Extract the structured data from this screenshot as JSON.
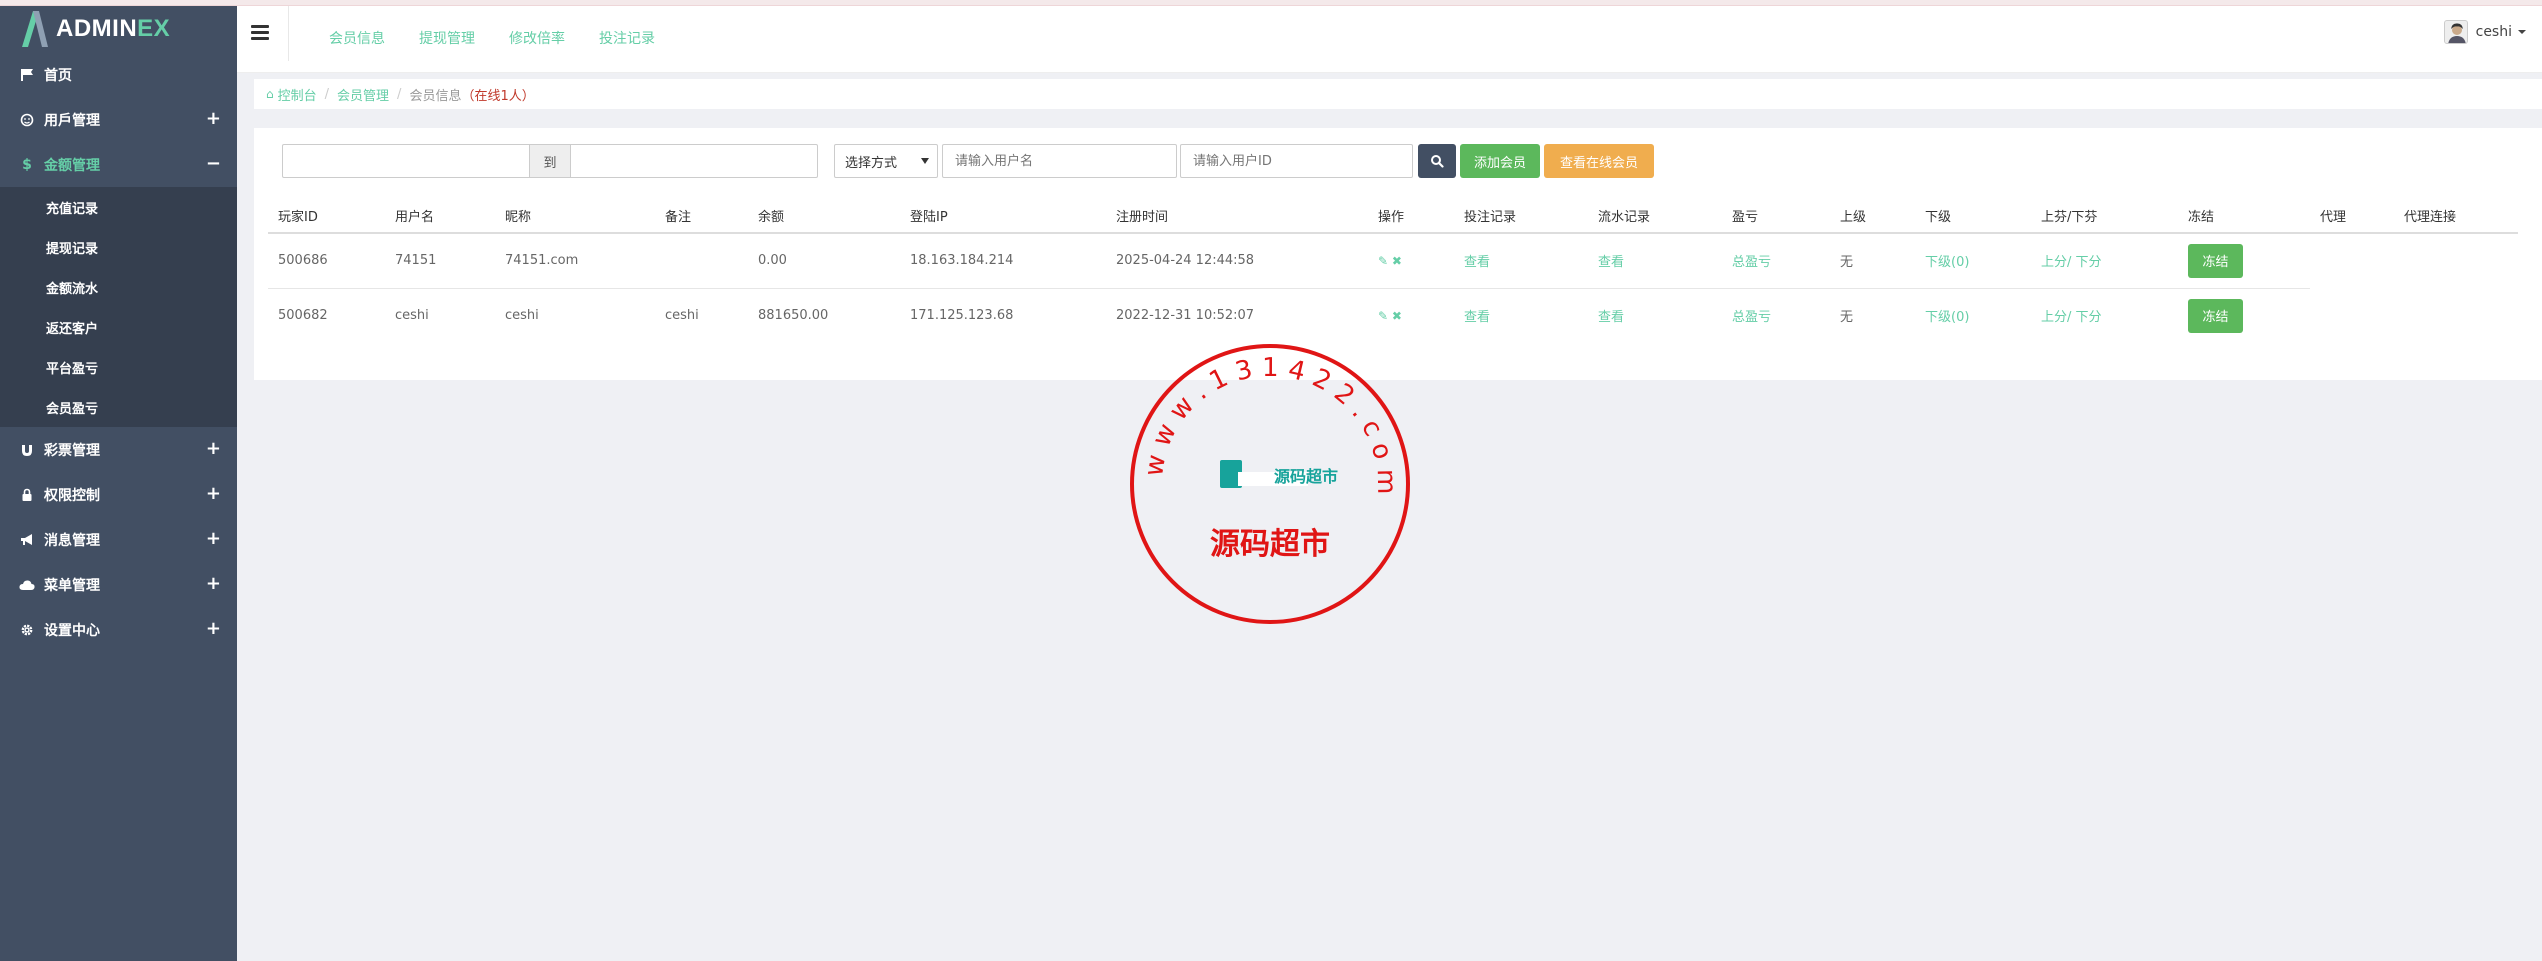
{
  "brand": {
    "name_main": "ADMIN",
    "name_accent": "EX"
  },
  "sidebar": {
    "items": [
      {
        "label": "首页",
        "icon": "flag-icon",
        "expandable": false
      },
      {
        "label": "用戶管理",
        "icon": "user-icon",
        "expandable": true,
        "toggle": "+"
      },
      {
        "label": "金额管理",
        "icon": "dollar-icon",
        "expandable": true,
        "toggle": "−",
        "active": true,
        "children": [
          "充值记录",
          "提现记录",
          "金额流水",
          "返还客户",
          "平台盈亏",
          "会员盈亏"
        ]
      },
      {
        "label": "彩票管理",
        "icon": "magnet-icon",
        "expandable": true,
        "toggle": "+"
      },
      {
        "label": "权限控制",
        "icon": "lock-icon",
        "expandable": true,
        "toggle": "+"
      },
      {
        "label": "消息管理",
        "icon": "bullhorn-icon",
        "expandable": true,
        "toggle": "+"
      },
      {
        "label": "菜单管理",
        "icon": "cloud-icon",
        "expandable": true,
        "toggle": "+"
      },
      {
        "label": "设置中心",
        "icon": "gear-icon",
        "expandable": true,
        "toggle": "+"
      }
    ]
  },
  "header": {
    "tabs": [
      "会员信息",
      "提现管理",
      "修改倍率",
      "投注记录"
    ],
    "user": "ceshi"
  },
  "breadcrumb": {
    "home": "控制台",
    "section": "会员管理",
    "current": "会员信息",
    "online": "（在线1人）"
  },
  "filters": {
    "range_sep": "到",
    "select_label": "选择方式",
    "username_placeholder": "请输入用户名",
    "userid_placeholder": "请输入用户ID",
    "add_member": "添加会员",
    "view_online": "查看在线会员"
  },
  "table": {
    "columns": [
      "玩家ID",
      "用户名",
      "昵称",
      "备注",
      "余额",
      "登陆IP",
      "注册时间",
      "操作",
      "投注记录",
      "流水记录",
      "盈亏",
      "上级",
      "下级",
      "上芬/下芬",
      "冻结",
      "代理",
      "代理连接"
    ],
    "rows": [
      {
        "id": "500686",
        "username": "74151",
        "nickname": "74151.com",
        "remark": "",
        "balance": "0.00",
        "ip": "18.163.184.214",
        "reg_time": "2025-04-24 12:44:58",
        "bets": "查看",
        "flow": "查看",
        "pnl": "总盈亏",
        "parent": "无",
        "children": "下级(0)",
        "updown": "上分/ 下分",
        "freeze": "冻结"
      },
      {
        "id": "500682",
        "username": "ceshi",
        "nickname": "ceshi",
        "remark": "ceshi",
        "balance": "881650.00",
        "ip": "171.125.123.68",
        "reg_time": "2022-12-31 10:52:07",
        "bets": "查看",
        "flow": "查看",
        "pnl": "总盈亏",
        "parent": "无",
        "children": "下级(0)",
        "updown": "上分/ 下分",
        "freeze": "冻结"
      }
    ]
  },
  "watermark": {
    "ring_text": "w w w . 1 3 1 4 2 2 . c o m",
    "center_text": "源码超市",
    "logo_text": "源码超市"
  },
  "colors": {
    "sidebar_bg": "#424f63",
    "accent": "#65cea7",
    "green_btn": "#5cb85c",
    "orange_btn": "#f0ad4e",
    "stamp_red": "#e01515"
  }
}
